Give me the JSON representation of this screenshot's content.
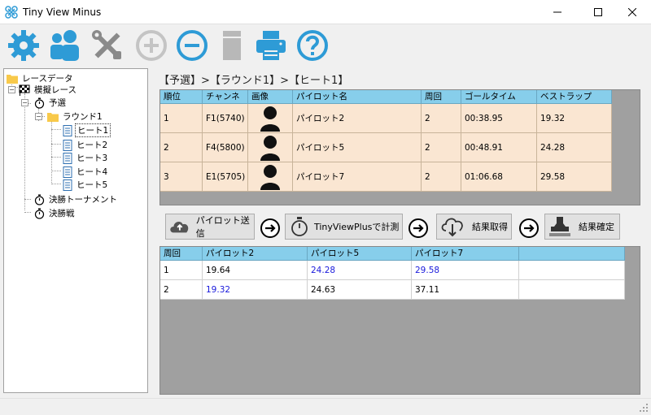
{
  "window": {
    "title": "Tiny View Minus"
  },
  "toolbar": {
    "buttons": [
      {
        "name": "settings-icon"
      },
      {
        "name": "pilots-icon"
      },
      {
        "name": "tools-icon"
      },
      {
        "name": "add-icon"
      },
      {
        "name": "remove-icon"
      },
      {
        "name": "document-icon"
      },
      {
        "name": "print-icon"
      },
      {
        "name": "help-icon"
      }
    ],
    "accent": "#2e9bd6"
  },
  "tree": {
    "root": "レースデータ",
    "race": "模擬レース",
    "qualifying": "予選",
    "round": "ラウンド1",
    "heats": [
      "ヒート1",
      "ヒート2",
      "ヒート3",
      "ヒート4",
      "ヒート5"
    ],
    "tournament": "決勝トーナメント",
    "final": "決勝戦"
  },
  "breadcrumb": "【予選】>【ラウンド1】>【ヒート1】",
  "results": {
    "headers": [
      "順位",
      "チャンネル",
      "画像",
      "パイロット名",
      "周回",
      "ゴールタイム",
      "ベストラップ"
    ],
    "rows": [
      {
        "rank": "1",
        "channel": "F1(5740)",
        "pilot": "パイロット2",
        "laps": "2",
        "goal": "00:38.95",
        "best": "19.32"
      },
      {
        "rank": "2",
        "channel": "F4(5800)",
        "pilot": "パイロット5",
        "laps": "2",
        "goal": "00:48.91",
        "best": "24.28"
      },
      {
        "rank": "3",
        "channel": "E1(5705)",
        "pilot": "パイロット7",
        "laps": "2",
        "goal": "01:06.68",
        "best": "29.58"
      }
    ]
  },
  "actions": {
    "send": "パイロット送信",
    "measure": "TinyViewPlusで計測",
    "fetch": "結果取得",
    "confirm": "結果確定"
  },
  "laps": {
    "headers": [
      "周回",
      "パイロット2",
      "パイロット5",
      "パイロット7"
    ],
    "rows": [
      {
        "lap": "1",
        "p2": "19.64",
        "p5": "24.28",
        "p7": "29.58"
      },
      {
        "lap": "2",
        "p2": "19.32",
        "p5": "24.63",
        "p7": "37.11"
      }
    ]
  }
}
